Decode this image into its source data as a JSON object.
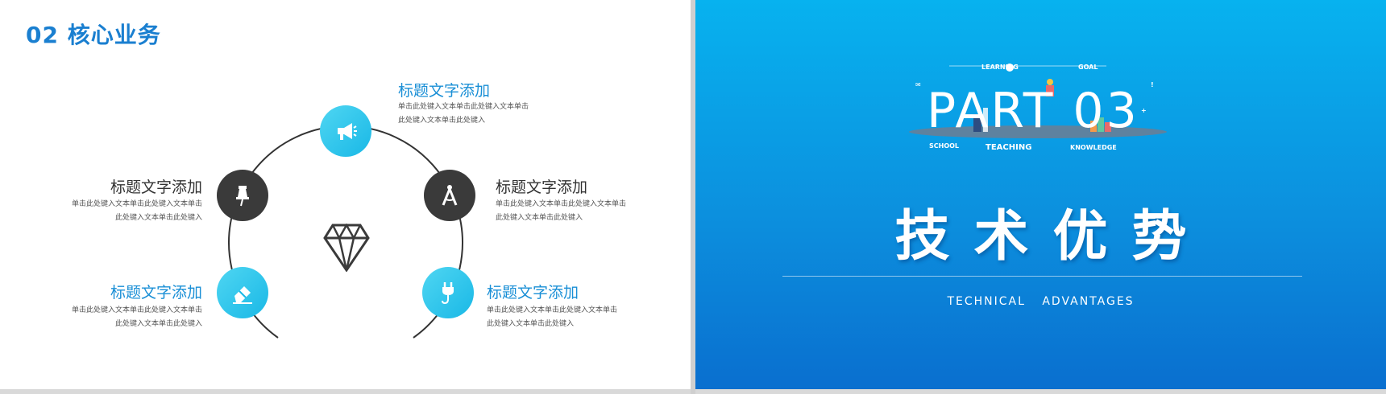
{
  "left_slide": {
    "section_title": "02 核心业务",
    "items": [
      {
        "title": "标题文字添加",
        "body": "单击此处键入文本单击此处键入文本单击此处键入文本单击此处键入",
        "icon": "megaphone-icon"
      },
      {
        "title": "标题文字添加",
        "body": "单击此处键入文本单击此处键入文本单击此处键入文本单击此处键入",
        "icon": "pushpin-icon"
      },
      {
        "title": "标题文字添加",
        "body": "单击此处键入文本单击此处键入文本单击此处键入文本单击此处键入",
        "icon": "compass-icon"
      },
      {
        "title": "标题文字添加",
        "body": "单击此处键入文本单击此处键入文本单击此处键入文本单击此处键入",
        "icon": "eraser-icon"
      },
      {
        "title": "标题文字添加",
        "body": "单击此处键入文本单击此处键入文本单击此处键入文本单击此处键入",
        "icon": "plug-icon"
      }
    ],
    "center_icon": "diamond-icon",
    "colors": {
      "accent": "#1a8fd6",
      "dark": "#3a3a3a",
      "cyan": "#19b8e6"
    }
  },
  "right_slide": {
    "part_label": "PART 03",
    "illustration_words": [
      "LEARNING",
      "GOAL",
      "SCHOOL",
      "TEACHING",
      "KNOWLEDGE"
    ],
    "title": "技术优势",
    "subtitle": "TECHNICAL ADVANTAGES",
    "colors": {
      "bg_top": "#07b2ef",
      "bg_bottom": "#0a6fcf"
    }
  }
}
